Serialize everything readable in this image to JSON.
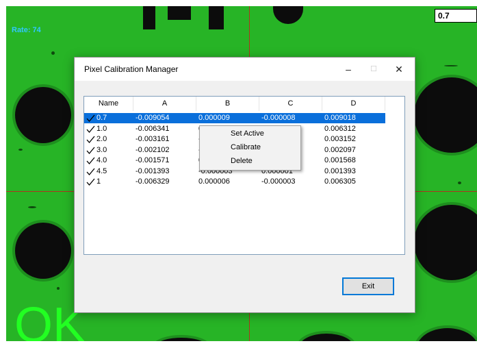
{
  "camera": {
    "rate_text": "Rate: 74",
    "status_text": "OK",
    "readout_value": "0.7"
  },
  "dialog": {
    "title": "Pixel Calibration Manager",
    "columns": [
      "Name",
      "A",
      "B",
      "C",
      "D"
    ],
    "rows": [
      {
        "name": "0.7",
        "a": "-0.009054",
        "b": "0.000009",
        "c": "-0.000008",
        "d": "0.009018",
        "checked": true,
        "selected": true
      },
      {
        "name": "1.0",
        "a": "-0.006341",
        "b": "0.",
        "c": "",
        "d": "0.006312",
        "checked": true,
        "selected": false
      },
      {
        "name": "2.0",
        "a": "-0.003161",
        "b": "-0",
        "c": "",
        "d": "0.003152",
        "checked": true,
        "selected": false
      },
      {
        "name": "3.0",
        "a": "-0.002102",
        "b": "-0",
        "c": "",
        "d": "0.002097",
        "checked": true,
        "selected": false
      },
      {
        "name": "4.0",
        "a": "-0.001571",
        "b": "0.",
        "c": "",
        "d": "0.001568",
        "checked": true,
        "selected": false
      },
      {
        "name": "4.5",
        "a": "-0.001393",
        "b": "-0.000003",
        "c": "0.000001",
        "d": "0.001393",
        "checked": true,
        "selected": false
      },
      {
        "name": "1",
        "a": "-0.006329",
        "b": "0.000006",
        "c": "-0.000003",
        "d": "0.006305",
        "checked": true,
        "selected": false
      }
    ],
    "exit_label": "Exit",
    "minimize_glyph": "–",
    "maximize_glyph": "☐",
    "close_glyph": "✕"
  },
  "context_menu": {
    "items": [
      "Set Active",
      "Calibrate",
      "Delete"
    ]
  },
  "colors": {
    "background_green": "#27b426",
    "selection_blue": "#0a6fdb",
    "crosshair_red": "#b0331f",
    "ok_green": "#22ff22",
    "rate_cyan": "#30c8ff"
  }
}
